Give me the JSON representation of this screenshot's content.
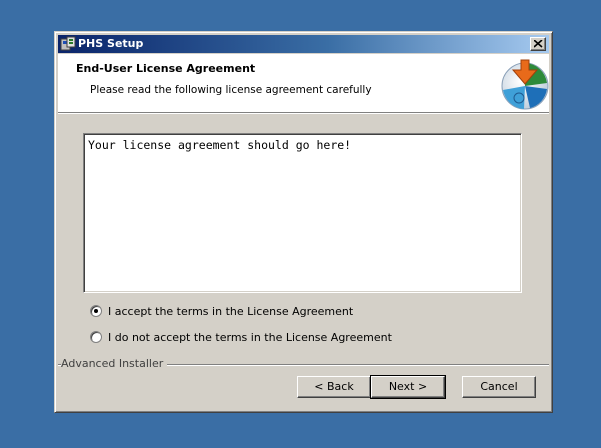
{
  "window": {
    "title": "PHS Setup",
    "close_glyph": "×"
  },
  "banner": {
    "title": "End-User License Agreement",
    "subtitle": "Please read the following license agreement carefully",
    "logo_icon": "installer-puzzle-logo"
  },
  "license": {
    "text": "Your license agreement should go here!"
  },
  "options": [
    {
      "label": "I accept the terms in the License Agreement",
      "selected": true
    },
    {
      "label": "I do not accept the terms in the License Agreement",
      "selected": false
    }
  ],
  "footer": {
    "brand": "Advanced Installer"
  },
  "buttons": {
    "back": "< Back",
    "next": "Next >",
    "cancel": "Cancel"
  },
  "colors": {
    "desktop": "#3a6ea5",
    "titlebar_start": "#0a246a",
    "titlebar_end": "#a6caf0",
    "dialog_face": "#d4d0c8"
  }
}
